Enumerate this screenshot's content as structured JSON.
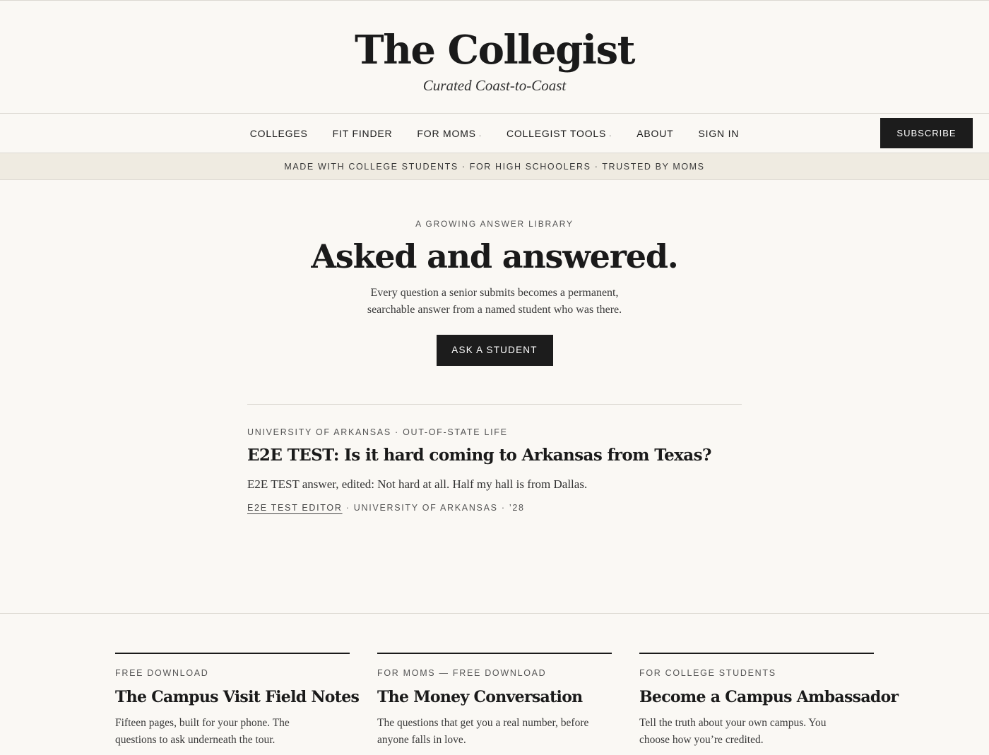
{
  "masthead": {
    "brand": "The Collegist",
    "tagline": "Curated Coast-to-Coast"
  },
  "nav": {
    "items": [
      {
        "label": "COLLEGES",
        "has_menu": false
      },
      {
        "label": "FIT FINDER",
        "has_menu": false
      },
      {
        "label": "FOR MOMS",
        "has_menu": true
      },
      {
        "label": "COLLEGIST TOOLS",
        "has_menu": true
      },
      {
        "label": "ABOUT",
        "has_menu": false
      },
      {
        "label": "SIGN IN",
        "has_menu": false
      }
    ],
    "caret": "·",
    "subscribe_label": "SUBSCRIBE"
  },
  "strip": {
    "text": "MADE WITH COLLEGE STUDENTS · FOR HIGH SCHOOLERS · TRUSTED BY MOMS"
  },
  "hero": {
    "eyebrow": "A GROWING ANSWER LIBRARY",
    "title": "Asked and answered.",
    "lede": "Every question a senior submits becomes a permanent, searchable answer from a named student who was there.",
    "cta_label": "ASK A STUDENT"
  },
  "answer": {
    "meta": "UNIVERSITY OF ARKANSAS · OUT-OF-STATE LIFE",
    "question": "E2E TEST: Is it hard coming to Arkansas from Texas?",
    "text": "E2E TEST answer, edited: Not hard at all. Half my hall is from Dallas.",
    "author": "E2E TEST EDITOR",
    "author_suffix": " · UNIVERSITY OF ARKANSAS · ’28"
  },
  "cards": [
    {
      "kicker": "FREE DOWNLOAD",
      "title": "The Campus Visit Field Notes",
      "body": "Fifteen pages, built for your phone. The questions to ask underneath the tour."
    },
    {
      "kicker": "FOR MOMS — FREE DOWNLOAD",
      "title": "The Money Conversation",
      "body": "The questions that get you a real number, before anyone falls in love."
    },
    {
      "kicker": "FOR COLLEGE STUDENTS",
      "title": "Become a Campus Ambassador",
      "body": "Tell the truth about your own campus. You choose how you’re credited."
    }
  ]
}
